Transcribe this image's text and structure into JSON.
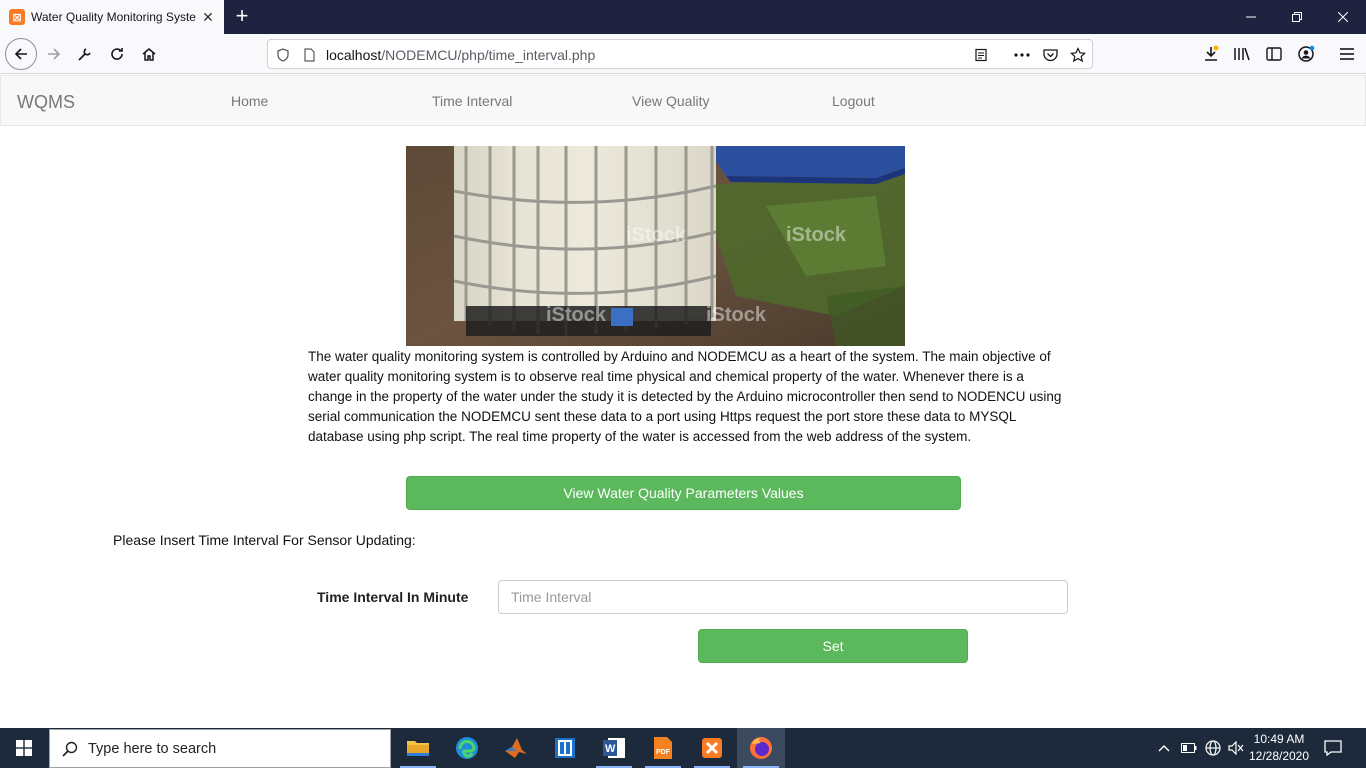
{
  "browser": {
    "tab_title": "Water Quality Monitoring System",
    "url_host": "localhost",
    "url_path": "/NODEMCU/php/time_interval.php"
  },
  "navbar": {
    "brand": "WQMS",
    "links": [
      "Home",
      "Time Interval",
      "View Quality",
      "Logout"
    ]
  },
  "main": {
    "description": "The water quality monitoring system is controlled by Arduino and NODEMCU as a heart of the system. The main objective of water quality monitoring system is to observe real time physical and chemical property of the water. Whenever there is a change in the property of the water under the study it is detected by the Arduino microcontroller then send to NODENCU using serial communication the NODEMCU sent these data to a port using Https request the port store these data to MYSQL database using php script. The real time property of the water is accessed from the web address of the system.",
    "view_button": "View Water Quality Parameters Values",
    "prompt": "Please Insert Time Interval For Sensor Updating:",
    "form": {
      "label": "Time Interval In Minute",
      "placeholder": "Time Interval",
      "value": "",
      "submit": "Set"
    },
    "image_watermark": "iStock"
  },
  "taskbar": {
    "search_placeholder": "Type here to search",
    "time": "10:49 AM",
    "date": "12/28/2020",
    "apps": [
      "file-explorer",
      "edge",
      "matlab",
      "app-viewer",
      "word",
      "pdf",
      "xampp",
      "firefox"
    ]
  },
  "colors": {
    "tabstrip": "#202340",
    "button_green": "#5cb85c",
    "navbar_bg": "#f8f8f8",
    "taskbar": "#1c2a3c"
  }
}
